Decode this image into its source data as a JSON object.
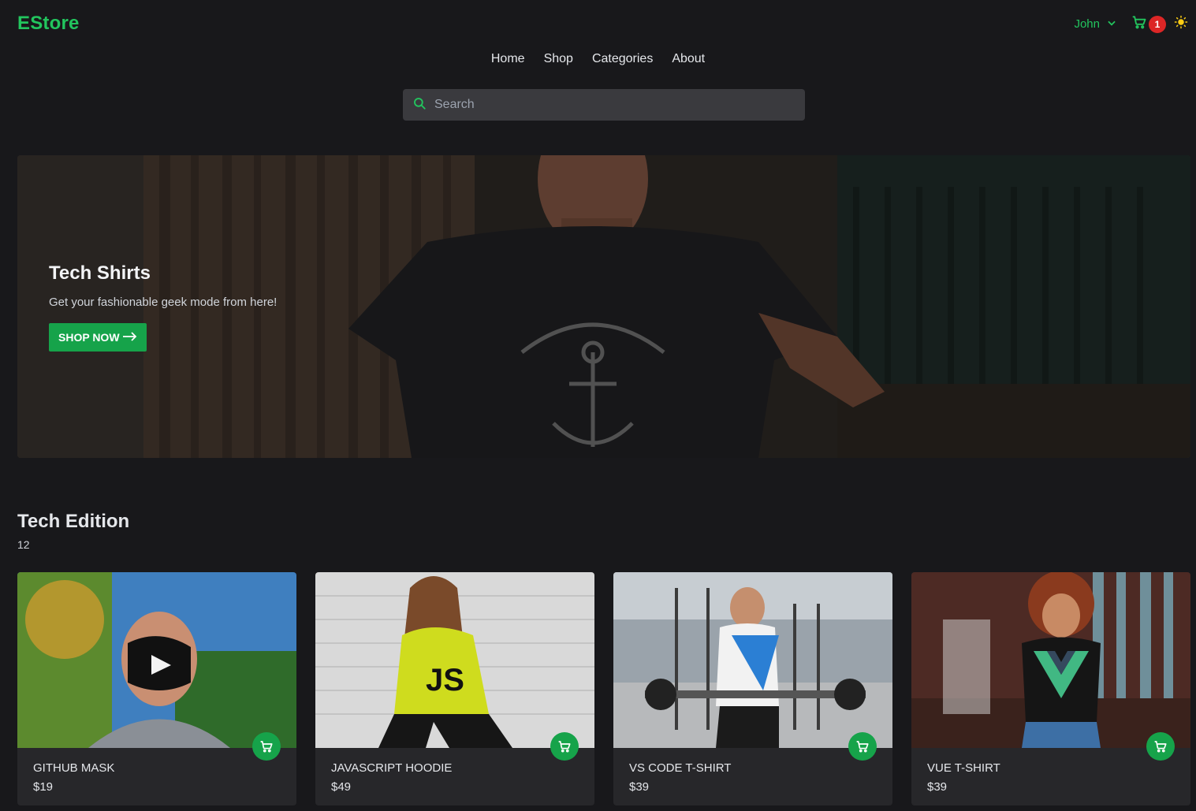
{
  "header": {
    "logo": "EStore",
    "user_name": "John",
    "cart_count": "1"
  },
  "nav": {
    "items": [
      "Home",
      "Shop",
      "Categories",
      "About"
    ]
  },
  "search": {
    "placeholder": "Search"
  },
  "hero": {
    "title": "Tech Shirts",
    "subtitle": "Get your fashionable geek mode from here!",
    "button_label": "SHOP NOW"
  },
  "section": {
    "title": "Tech Edition",
    "count": "12"
  },
  "products": [
    {
      "name": "GITHUB MASK",
      "price": "$19"
    },
    {
      "name": "JAVASCRIPT HOODIE",
      "price": "$49"
    },
    {
      "name": "VS CODE T-SHIRT",
      "price": "$39"
    },
    {
      "name": "VUE T-SHIRT",
      "price": "$39"
    }
  ],
  "colors": {
    "accent": "#22c55e",
    "button": "#16a34a",
    "badge": "#dc2626",
    "background": "#18181b",
    "card": "#27272a"
  }
}
